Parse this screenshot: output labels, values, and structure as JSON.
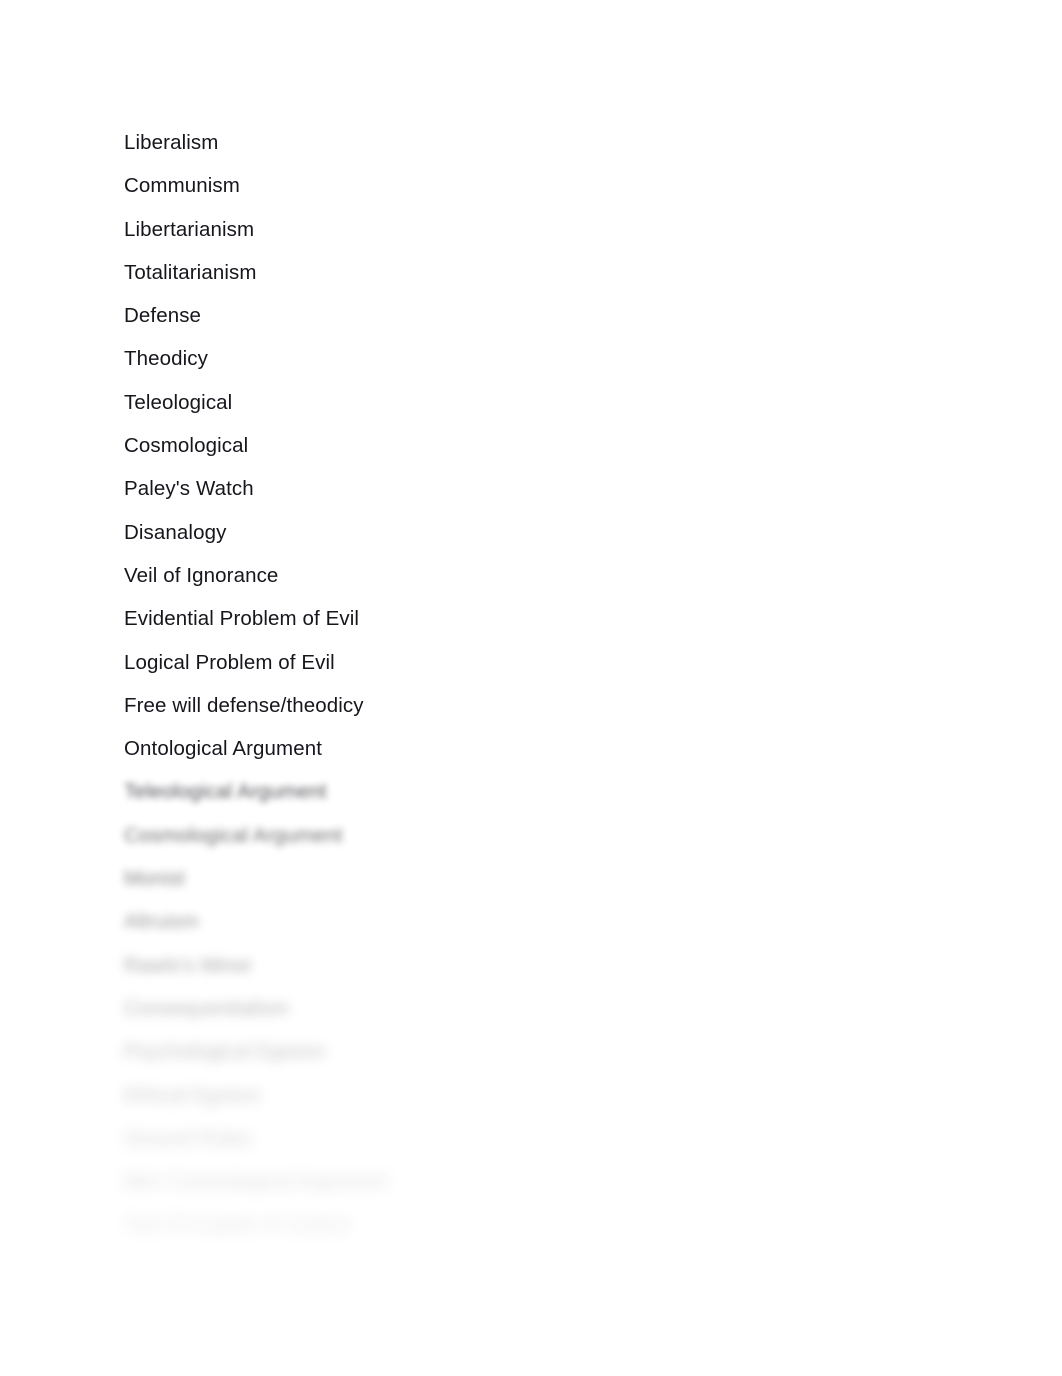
{
  "document": {
    "background_color": "#ffffff",
    "text_color": "#16161d",
    "terms": [
      {
        "label": "Liberalism",
        "obscured": false
      },
      {
        "label": "Communism",
        "obscured": false
      },
      {
        "label": "Libertarianism",
        "obscured": false
      },
      {
        "label": "Totalitarianism",
        "obscured": false
      },
      {
        "label": "Defense",
        "obscured": false
      },
      {
        "label": "Theodicy",
        "obscured": false
      },
      {
        "label": "Teleological",
        "obscured": false
      },
      {
        "label": "Cosmological",
        "obscured": false
      },
      {
        "label": "Paley's Watch",
        "obscured": false
      },
      {
        "label": "Disanalogy",
        "obscured": false
      },
      {
        "label": "Veil of Ignorance",
        "obscured": false
      },
      {
        "label": "Evidential Problem of Evil",
        "obscured": false
      },
      {
        "label": "Logical Problem of Evil",
        "obscured": false
      },
      {
        "label": "Free will defense/theodicy",
        "obscured": false
      },
      {
        "label": "Ontological Argument",
        "obscured": false
      },
      {
        "label": "Teleological Argument",
        "obscured": true
      },
      {
        "label": "Cosmological Argument",
        "obscured": true
      },
      {
        "label": "Monist",
        "obscured": true
      },
      {
        "label": "Altruism",
        "obscured": true
      },
      {
        "label": "Rawls's Minor",
        "obscured": true
      },
      {
        "label": "Consequentialism",
        "obscured": true
      },
      {
        "label": "Psychological Egoism",
        "obscured": true
      },
      {
        "label": "Ethical Egoism",
        "obscured": true
      },
      {
        "label": "Ground Rules",
        "obscured": true
      },
      {
        "label": "Mini Cosmological Argument",
        "obscured": true
      },
      {
        "label": "Two Principles of Justice",
        "obscured": true
      }
    ]
  }
}
